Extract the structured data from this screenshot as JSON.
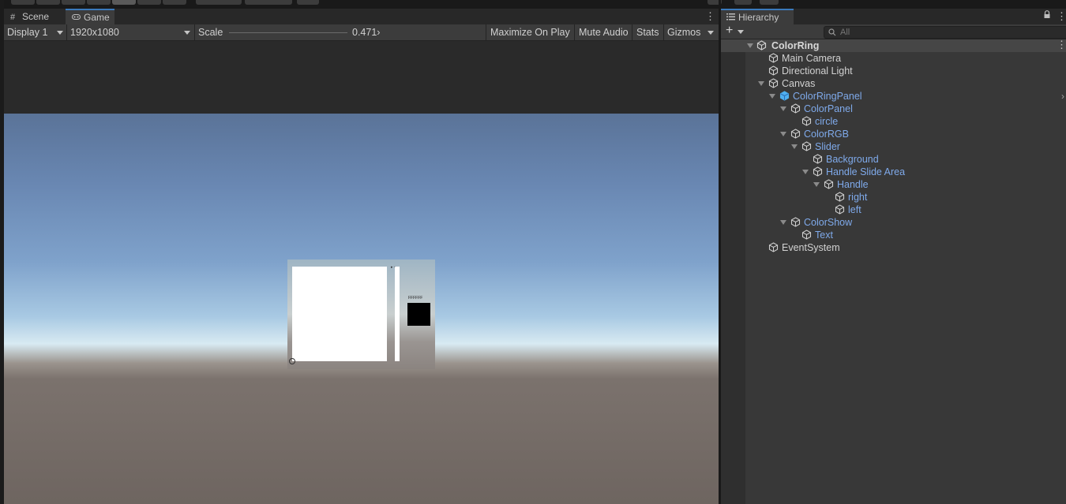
{
  "game_view": {
    "tabs": [
      {
        "label": "Scene",
        "icon": "grid-icon"
      },
      {
        "label": "Game",
        "icon": "gamepad-icon"
      }
    ],
    "toolbar": {
      "display": "Display 1",
      "resolution": "1920x1080",
      "scale_label": "Scale",
      "scale_value": "0.471›",
      "maximize": "Maximize On Play",
      "mute": "Mute Audio",
      "stats": "Stats",
      "gizmos": "Gizmos"
    },
    "panel": {
      "label_text": "FFFFFF"
    }
  },
  "hierarchy": {
    "title": "Hierarchy",
    "search_placeholder": "All",
    "scene": "ColorRing",
    "items": [
      {
        "label": "Main Camera",
        "depth": 1,
        "expanded": null,
        "prefab": false
      },
      {
        "label": "Directional Light",
        "depth": 1,
        "expanded": null,
        "prefab": false
      },
      {
        "label": "Canvas",
        "depth": 1,
        "expanded": true,
        "prefab": false
      },
      {
        "label": "ColorRingPanel",
        "depth": 2,
        "expanded": true,
        "prefab": true,
        "root": true
      },
      {
        "label": "ColorPanel",
        "depth": 3,
        "expanded": true,
        "prefab": true
      },
      {
        "label": "circle",
        "depth": 4,
        "expanded": null,
        "prefab": true
      },
      {
        "label": "ColorRGB",
        "depth": 3,
        "expanded": true,
        "prefab": true
      },
      {
        "label": "Slider",
        "depth": 4,
        "expanded": true,
        "prefab": true
      },
      {
        "label": "Background",
        "depth": 5,
        "expanded": null,
        "prefab": true
      },
      {
        "label": "Handle Slide Area",
        "depth": 5,
        "expanded": true,
        "prefab": true
      },
      {
        "label": "Handle",
        "depth": 6,
        "expanded": true,
        "prefab": true
      },
      {
        "label": "right",
        "depth": 7,
        "expanded": null,
        "prefab": true
      },
      {
        "label": "left",
        "depth": 7,
        "expanded": null,
        "prefab": true
      },
      {
        "label": "ColorShow",
        "depth": 3,
        "expanded": true,
        "prefab": true
      },
      {
        "label": "Text",
        "depth": 4,
        "expanded": null,
        "prefab": true
      },
      {
        "label": "EventSystem",
        "depth": 1,
        "expanded": null,
        "prefab": false
      }
    ]
  },
  "colors": {
    "accent": "#3a79bb",
    "prefab_text": "#7faaeb"
  }
}
